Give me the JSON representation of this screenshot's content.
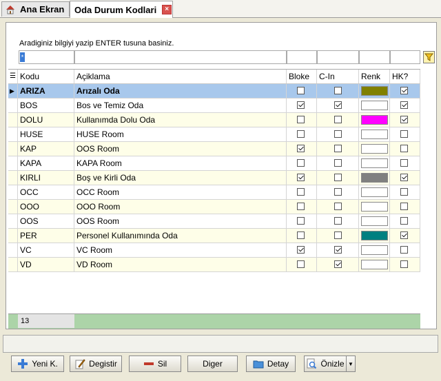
{
  "tabs": [
    {
      "label": "Ana Ekran"
    },
    {
      "label": "Oda Durum Kodlari"
    }
  ],
  "search": {
    "hint": "Aradiginiz bilgiyi yazip ENTER tusuna basiniz.",
    "caret": "*"
  },
  "grid": {
    "columns": [
      "Kodu",
      "Açiklama",
      "Bloke",
      "C-In",
      "Renk",
      "HK?"
    ],
    "rows": [
      {
        "kodu": "ARIZA",
        "aciklama": "Arızalı Oda",
        "bloke": false,
        "cin": false,
        "renk": "#808000",
        "hk": true
      },
      {
        "kodu": "BOS",
        "aciklama": "Bos ve Temiz Oda",
        "bloke": true,
        "cin": true,
        "renk": "#FFFFFF",
        "hk": true
      },
      {
        "kodu": "DOLU",
        "aciklama": "Kullanımda Dolu Oda",
        "bloke": false,
        "cin": false,
        "renk": "#FF00FF",
        "hk": true
      },
      {
        "kodu": "HUSE",
        "aciklama": "HUSE Room",
        "bloke": false,
        "cin": false,
        "renk": "#FFFFFF",
        "hk": false
      },
      {
        "kodu": "KAP",
        "aciklama": "OOS Room",
        "bloke": true,
        "cin": false,
        "renk": "#FFFFFF",
        "hk": false
      },
      {
        "kodu": "KAPA",
        "aciklama": "KAPA Room",
        "bloke": false,
        "cin": false,
        "renk": "#FFFFFF",
        "hk": false
      },
      {
        "kodu": "KIRLI",
        "aciklama": "Boş ve Kirli Oda",
        "bloke": true,
        "cin": false,
        "renk": "#808080",
        "hk": true
      },
      {
        "kodu": "OCC",
        "aciklama": "OCC Room",
        "bloke": false,
        "cin": false,
        "renk": "#FFFFFF",
        "hk": false
      },
      {
        "kodu": "OOO",
        "aciklama": "OOO Room",
        "bloke": false,
        "cin": false,
        "renk": "#FFFFFF",
        "hk": false
      },
      {
        "kodu": "OOS",
        "aciklama": "OOS Room",
        "bloke": false,
        "cin": false,
        "renk": "#FFFFFF",
        "hk": false
      },
      {
        "kodu": "PER",
        "aciklama": "Personel Kullanımında Oda",
        "bloke": false,
        "cin": false,
        "renk": "#008080",
        "hk": true
      },
      {
        "kodu": "VC",
        "aciklama": "VC Room",
        "bloke": true,
        "cin": true,
        "renk": "#FFFFFF",
        "hk": false
      },
      {
        "kodu": "VD",
        "aciklama": "VD Room",
        "bloke": false,
        "cin": true,
        "renk": "#FFFFFF",
        "hk": false
      }
    ],
    "record_count": "13"
  },
  "buttons": {
    "yeni": "Yeni K.",
    "degistir": "Degistir",
    "sil": "Sil",
    "diger": "Diger",
    "detay": "Detay",
    "onizle": "Önizle"
  },
  "icons": {
    "home": "home-icon",
    "close": "close-icon",
    "filter": "filter-icon",
    "add": "plus-icon",
    "edit": "pencil-icon",
    "delete": "minus-icon",
    "detail": "folder-icon",
    "preview": "magnifier-icon"
  }
}
